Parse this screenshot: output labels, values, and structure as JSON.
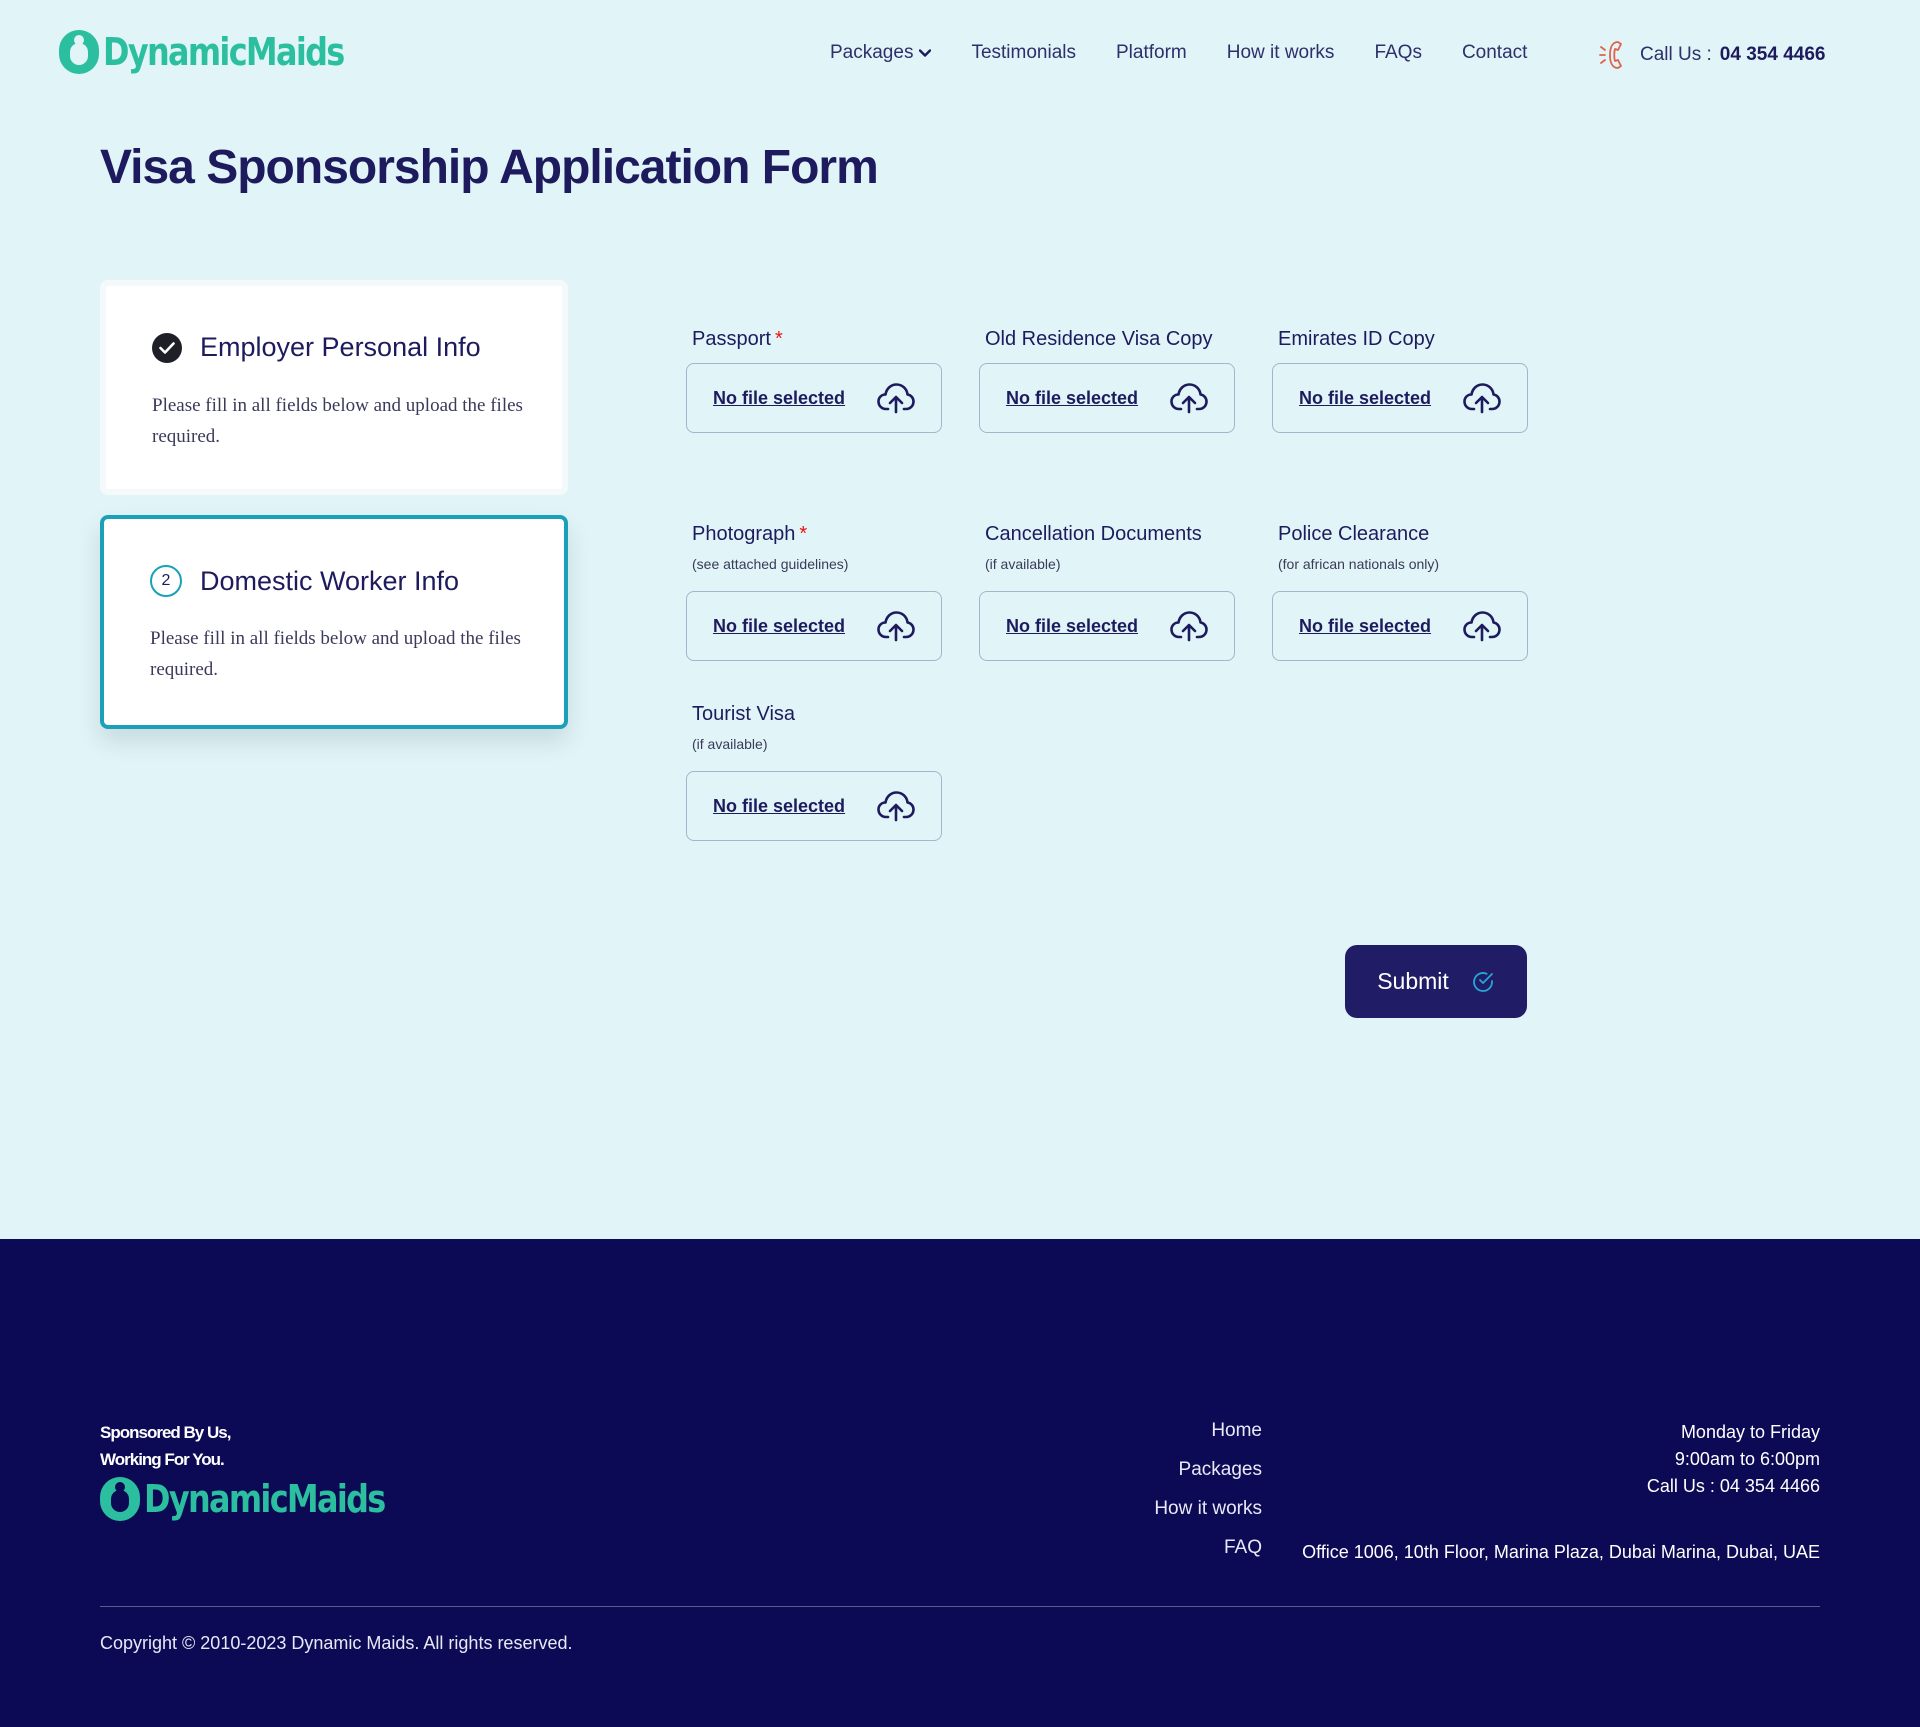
{
  "header": {
    "logo_text": "DynamicMaids",
    "nav": [
      {
        "label": "Packages",
        "has_dropdown": true
      },
      {
        "label": "Testimonials"
      },
      {
        "label": "Platform"
      },
      {
        "label": "How it works"
      },
      {
        "label": "FAQs"
      },
      {
        "label": "Contact"
      }
    ],
    "call_label": "Call Us :",
    "call_number": "04 354 4466"
  },
  "page_title": "Visa Sponsorship Application Form",
  "steps": [
    {
      "title": "Employer Personal Info",
      "status": "completed",
      "description": "Please fill in all fields below and upload the files required."
    },
    {
      "title": "Domestic Worker Info",
      "number": "2",
      "status": "active",
      "description": "Please fill in all fields below and upload the files required."
    }
  ],
  "uploads": [
    {
      "label": "Passport",
      "required": true,
      "hint": "",
      "value": "No file selected"
    },
    {
      "label": "Old Residence Visa Copy",
      "required": false,
      "hint": "",
      "value": "No file selected"
    },
    {
      "label": "Emirates ID Copy",
      "required": false,
      "hint": "",
      "value": "No file selected"
    },
    {
      "label": "Photograph",
      "required": true,
      "hint": "(see attached guidelines)",
      "value": "No file selected"
    },
    {
      "label": "Cancellation Documents",
      "required": false,
      "hint": "(if available)",
      "value": "No file selected"
    },
    {
      "label": "Police Clearance",
      "required": false,
      "hint": "(for african nationals only)",
      "value": "No file selected"
    },
    {
      "label": "Tourist Visa",
      "required": false,
      "hint": "(if available)",
      "value": "No file selected"
    }
  ],
  "required_mark": "*",
  "submit_label": "Submit",
  "footer": {
    "tagline_line1": "Sponsored By Us,",
    "tagline_line2": "Working For You.",
    "logo_text": "DynamicMaids",
    "links": [
      "Home",
      "Packages",
      "How it works",
      "FAQ"
    ],
    "hours_days": "Monday to Friday",
    "hours_time": "9:00am to 6:00pm",
    "call": "Call Us : 04 354 4466",
    "address": "Office 1006, 10th Floor, Marina Plaza, Dubai Marina, Dubai, UAE",
    "copyright": "Copyright © 2010-2023 Dynamic Maids. All rights reserved."
  },
  "colors": {
    "background": "#e1f4f7",
    "navy": "#1d1b5e",
    "teal": "#1aa0b8",
    "brand_green": "#2bbfa0",
    "footer_bg": "#0d0a55",
    "required_red": "#e11111"
  }
}
